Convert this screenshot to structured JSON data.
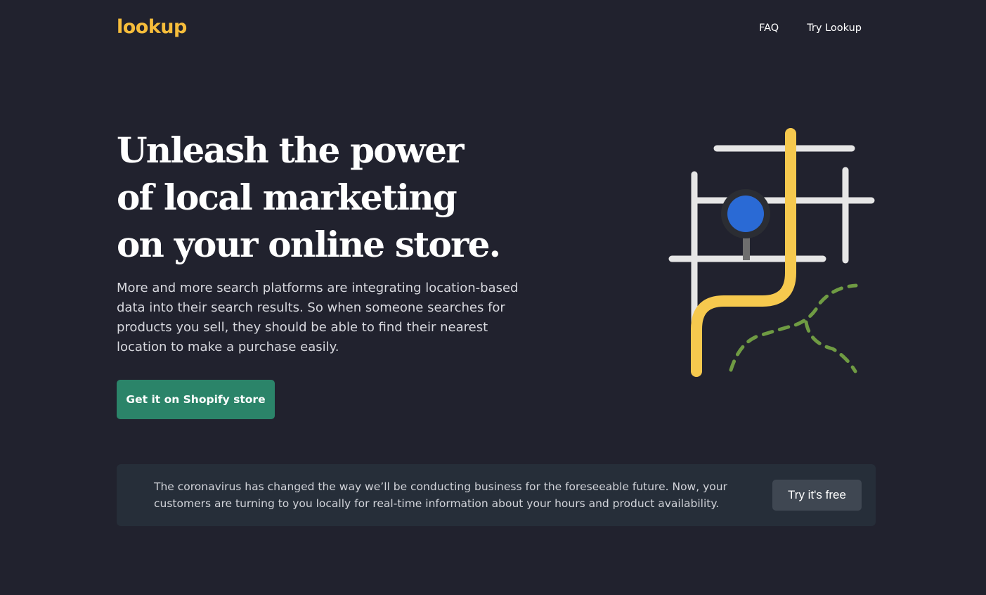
{
  "header": {
    "logo": "lookup",
    "nav": [
      {
        "label": "FAQ"
      },
      {
        "label": "Try Lookup"
      }
    ]
  },
  "hero": {
    "headline_lines": [
      "Unleash the power",
      "of local marketing",
      "on your online store."
    ],
    "lead": "More and more search platforms are integrating location-based data into their search results. So when someone searches for products you sell, they should be able to find their nearest location to make a purchase easily.",
    "cta_label": "Get it on Shopify store"
  },
  "illustration": {
    "icon": "map-route-illustration",
    "colors": {
      "streets": "#e6e6e6",
      "route": "#f6c94e",
      "pin": "#2a6ad5",
      "pin_ring": "#2b2d33",
      "pin_stem": "#6e6e6e",
      "trail": "#6f9b43"
    }
  },
  "banner": {
    "text": "The coronavirus has changed the way we’ll be conducting business for the foreseeable future. Now, your customers are turning to you locally for real-time information about your hours and product availability.",
    "button_label": "Try it's free"
  },
  "colors": {
    "background": "#21222e",
    "brand": "#f6bd3b",
    "cta": "#2b8469",
    "banner_bg": "#262e39",
    "banner_button": "#3f4752"
  }
}
